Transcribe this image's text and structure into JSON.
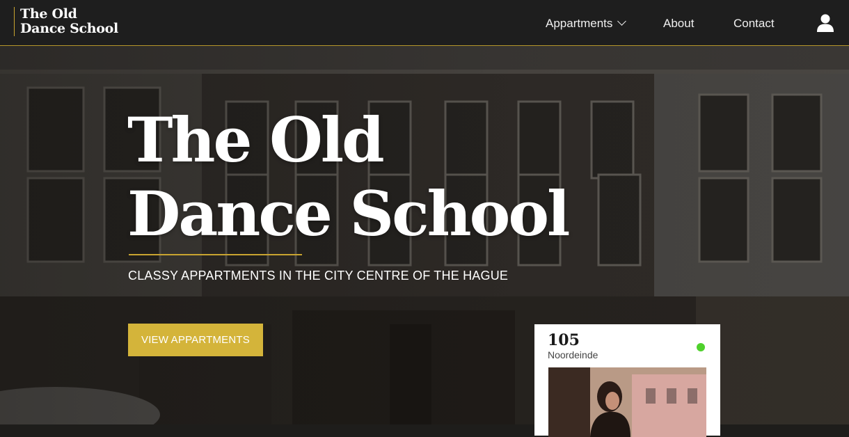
{
  "brand": {
    "line1": "The Old",
    "line2": "Dance School"
  },
  "nav": {
    "items": [
      {
        "label": "Appartments",
        "dropdown": true
      },
      {
        "label": "About"
      },
      {
        "label": "Contact"
      }
    ],
    "user_icon": "user-icon"
  },
  "hero": {
    "title_line1": "The Old",
    "title_line2": "Dance School",
    "subtitle": "CLASSY APPARTMENTS IN THE CITY CENTRE OF THE HAGUE",
    "cta_label": "VIEW APPARTMENTS"
  },
  "card": {
    "number": "105",
    "street": "Noordeinde",
    "status_color": "#4fd12c"
  },
  "colors": {
    "accent": "#d4b43a",
    "nav_bg": "#1e1e1e",
    "rule": "#c9a430"
  }
}
